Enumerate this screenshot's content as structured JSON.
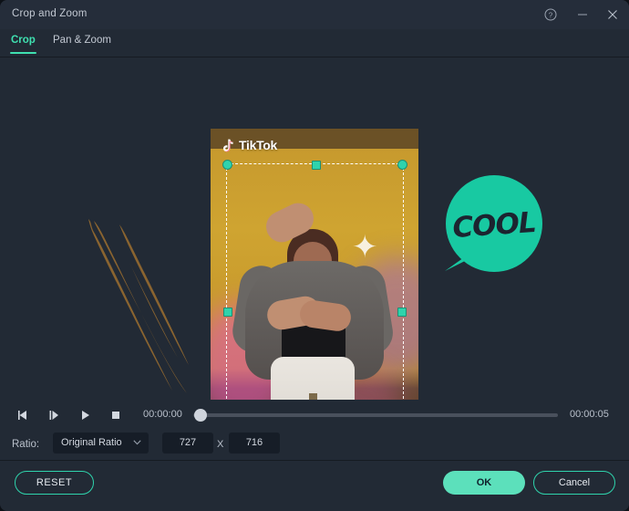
{
  "window": {
    "title": "Crop and Zoom",
    "controls": [
      {
        "name": "help-button",
        "icon": "question-circle-icon",
        "label": "?"
      },
      {
        "name": "minimize-button",
        "icon": "minimize-icon",
        "label": "—"
      },
      {
        "name": "close-button",
        "icon": "close-icon",
        "label": "✕"
      }
    ]
  },
  "tabs": {
    "crop": "Crop",
    "pan_zoom": "Pan & Zoom",
    "active": "Crop"
  },
  "preview": {
    "watermark": "TikTok",
    "watermark_icon": "tiktok-note-icon",
    "sticker_text": "COOL",
    "sticker_icon": "speech-bubble-icon",
    "brush_icon": "brush-stroke-icon",
    "crop_handles": [
      "top-left",
      "top-middle",
      "top-right",
      "left-middle",
      "right-middle",
      "bottom-left",
      "bottom-middle",
      "bottom-right"
    ]
  },
  "transport": {
    "prev_frame_icon": "previous-frame-icon",
    "next_frame_icon": "next-frame-icon",
    "play_icon": "play-icon",
    "stop_icon": "stop-icon",
    "current_time": "00:00:00",
    "total_time": "00:00:05",
    "progress_percent": 2
  },
  "ratio": {
    "label": "Ratio:",
    "selected": "Original Ratio",
    "caret_icon": "chevron-down-icon",
    "width": "727",
    "separator": "X",
    "height": "716"
  },
  "footer": {
    "reset": "RESET",
    "ok": "OK",
    "cancel": "Cancel"
  },
  "colors": {
    "accent": "#2fd3ac",
    "accent_fill": "#5ce0bb",
    "window_bg": "#222a35",
    "titlebar_bg": "#252d3a",
    "input_bg": "#161d27"
  }
}
